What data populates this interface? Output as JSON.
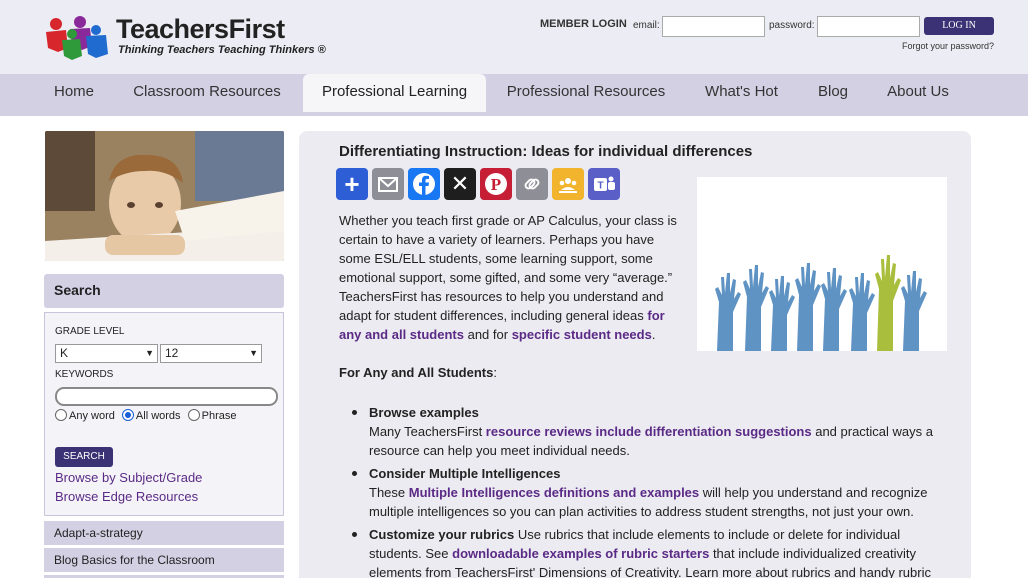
{
  "brand": {
    "title": "TeachersFirst",
    "tagline": "Thinking Teachers Teaching Thinkers ®"
  },
  "login": {
    "title": "MEMBER LOGIN",
    "email_label": "email:",
    "password_label": "password:",
    "button": "LOG IN",
    "forgot": "Forgot your password?"
  },
  "nav": {
    "items": [
      {
        "label": "Home"
      },
      {
        "label": "Classroom Resources"
      },
      {
        "label": "Professional Learning"
      },
      {
        "label": "Professional Resources"
      },
      {
        "label": "What's Hot"
      },
      {
        "label": "Blog"
      },
      {
        "label": "About Us"
      }
    ],
    "active": "Professional Learning"
  },
  "sidebar": {
    "search_title": "Search",
    "grade_label": "GRADE LEVEL",
    "grade_from": "K",
    "grade_to": "12",
    "keywords_label": "KEYWORDS",
    "radio": {
      "any": "Any word",
      "all": "All words",
      "phrase": "Phrase",
      "selected": "All words"
    },
    "search_button": "SEARCH",
    "browse_subject": "Browse by Subject/Grade",
    "browse_edge": "Browse Edge Resources",
    "links": [
      {
        "label": "Adapt-a-strategy"
      },
      {
        "label": "Blog Basics for the Classroom"
      }
    ]
  },
  "article": {
    "title": "Differentiating Instruction: Ideas for individual differences",
    "share_icons": [
      "plus-icon",
      "email-icon",
      "facebook-icon",
      "x-icon",
      "pinterest-icon",
      "copy-link-icon",
      "google-classroom-icon",
      "teams-icon"
    ],
    "intro_text": "Whether you teach first grade or AP Calculus, your class is certain to have a variety of learners. Perhaps you have some ESL/ELL students, some learning support, some emotional support, some gifted, and some very “average.” TeachersFirst has resources to help you understand and adapt for student differences, including general ideas ",
    "intro_link1": "for any and all students",
    "intro_and": " and for ",
    "intro_link2": "specific student needs",
    "intro_end": ".",
    "section_heading": "For Any and All Students",
    "section_colon": ":",
    "bullets": [
      {
        "head": "Browse examples",
        "pre": "Many TeachersFirst ",
        "link": "resource reviews include differentiation suggestions",
        "post": " and practical ways a resource can help you meet individual needs."
      },
      {
        "head": "Consider Multiple Intelligences",
        "pre": "These ",
        "link": "Multiple Intelligences definitions and examples",
        "post": " will help you understand and recognize multiple intelligences so you can plan activities to address student strengths, not just your own."
      },
      {
        "head": "Customize your rubrics",
        "pre": " Use rubrics that include elements to include or delete for individual students. See ",
        "link": "downloadable examples of rubric starters",
        "post": " that include individualized creativity elements from TeachersFirst' Dimensions of Creativity. Learn more about rubrics and handy rubric"
      }
    ]
  },
  "colors": {
    "nav_bg": "#d4d0e4",
    "header_bg": "#ececf4",
    "button": "#3a3274",
    "link": "#5b2a86",
    "share_blue": "#2d5ed6",
    "share_dark": "#1e1e1e",
    "share_pinterest": "#c61f35",
    "share_gray": "#8e8e96",
    "share_gold": "#f2b42c",
    "share_teams": "#5a5fc8"
  }
}
